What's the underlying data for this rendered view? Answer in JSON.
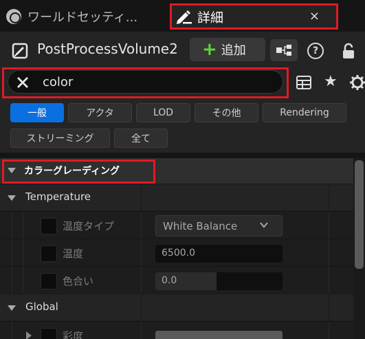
{
  "tabs": [
    {
      "label": "ワールドセッティ..."
    },
    {
      "label": "詳細",
      "close": "×"
    }
  ],
  "header": {
    "actor_name": "PostProcessVolume2",
    "add_label": "追加"
  },
  "search": {
    "value": "color",
    "placeholder": ""
  },
  "filters": [
    {
      "label": "一般",
      "active": true
    },
    {
      "label": "アクタ",
      "active": false
    },
    {
      "label": "LOD",
      "active": false
    },
    {
      "label": "その他",
      "active": false
    },
    {
      "label": "Rendering",
      "active": false
    },
    {
      "label": "ストリーミング",
      "active": false
    },
    {
      "label": "全て",
      "active": false
    }
  ],
  "tree": {
    "category": "カラーグレーディング",
    "temperature": {
      "label": "Temperature",
      "props": [
        {
          "label": "温度タイプ",
          "value": "White Balance"
        },
        {
          "label": "温度",
          "value": "6500.0"
        },
        {
          "label": "色合い",
          "value": "0.0"
        }
      ]
    },
    "global": {
      "label": "Global",
      "props": [
        {
          "label": "彩度"
        }
      ]
    }
  },
  "colors": {
    "highlight": "#e01b24",
    "accent": "#0a70e0",
    "add_plus": "#5fd43e"
  },
  "values": {
    "tint_fill_fraction": 0.48
  }
}
